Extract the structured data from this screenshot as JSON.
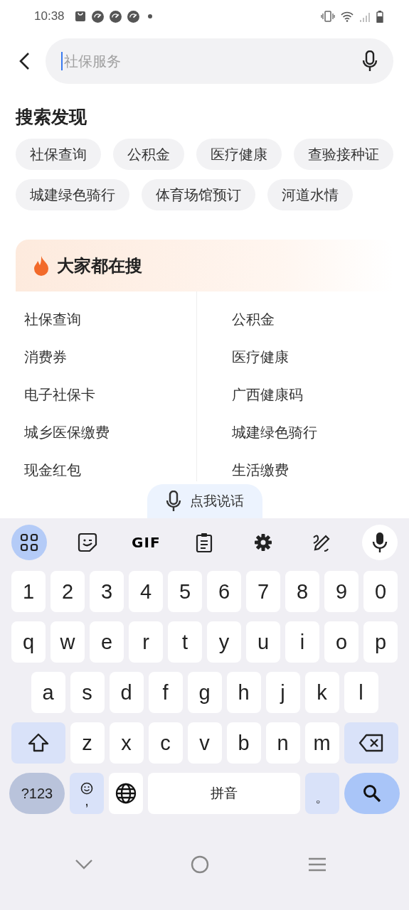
{
  "status_bar": {
    "time": "10:38"
  },
  "search": {
    "placeholder": "社保服务"
  },
  "discover": {
    "title": "搜索发现",
    "chips": [
      "社保查询",
      "公积金",
      "医疗健康",
      "查验接种证",
      "城建绿色骑行",
      "体育场馆预订",
      "河道水情"
    ]
  },
  "trending": {
    "title": "大家都在搜",
    "items": [
      "社保查询",
      "公积金",
      "消费券",
      "医疗健康",
      "电子社保卡",
      "广西健康码",
      "城乡医保缴费",
      "城建绿色骑行",
      "现金红包",
      "生活缴费"
    ]
  },
  "voice_button": {
    "label": "点我说话"
  },
  "keyboard": {
    "toolbar": [
      {
        "kind": "apps",
        "selected": true
      },
      {
        "kind": "sticker",
        "selected": false
      },
      {
        "kind": "gif",
        "label": "GIF",
        "selected": false
      },
      {
        "kind": "clipboard",
        "selected": false
      },
      {
        "kind": "settings",
        "selected": false
      },
      {
        "kind": "handwriting",
        "selected": false
      },
      {
        "kind": "mic"
      }
    ],
    "rows": [
      [
        "1",
        "2",
        "3",
        "4",
        "5",
        "6",
        "7",
        "8",
        "9",
        "0"
      ],
      [
        "q",
        "w",
        "e",
        "r",
        "t",
        "y",
        "u",
        "i",
        "o",
        "p"
      ],
      [
        "a",
        "s",
        "d",
        "f",
        "g",
        "h",
        "j",
        "k",
        "l"
      ]
    ],
    "shift_row": [
      "z",
      "x",
      "c",
      "v",
      "b",
      "n",
      "m"
    ],
    "bottom_row": [
      {
        "kind": "symbols",
        "label": "?123"
      },
      {
        "kind": "emoji",
        "label": ","
      },
      {
        "kind": "globe"
      },
      {
        "kind": "space",
        "label": "拼音"
      },
      {
        "kind": "period",
        "label": "。"
      },
      {
        "kind": "search"
      }
    ]
  }
}
